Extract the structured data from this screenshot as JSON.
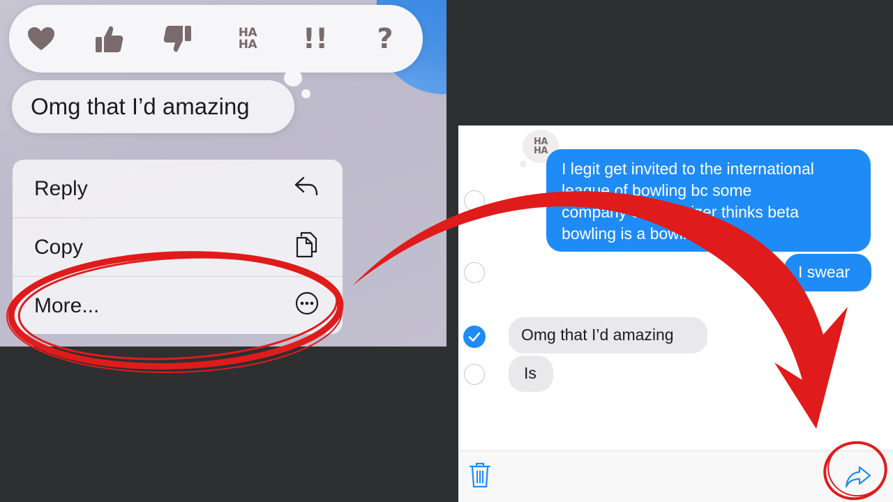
{
  "tapbacks": {
    "heart": "heart-icon",
    "thumbs_up": "thumbs-up-icon",
    "thumbs_down": "thumbs-down-icon",
    "haha_line1": "HA",
    "haha_line2": "HA",
    "emphasis": "!!",
    "question": "?"
  },
  "left_message": "Omg that I’d amazing",
  "context_menu": {
    "reply": "Reply",
    "copy": "Copy",
    "more": "More..."
  },
  "right_thread": {
    "reaction_line1": "HA",
    "reaction_line2": "HA",
    "messages": [
      {
        "text": "I legit get invited to the international league of bowling bc some company or organizer thinks beta bowling is a bowling club",
        "sender": "me"
      },
      {
        "text": "I swear",
        "sender": "me"
      },
      {
        "text": "Omg that I’d amazing",
        "sender": "them",
        "selected": true
      },
      {
        "text": "Is",
        "sender": "them",
        "selected": false
      }
    ],
    "message_lines": [
      "I legit get invited to the international",
      "league of bowling bc some",
      "company or organizer thinks beta",
      "bowling is a bowling club"
    ]
  },
  "toolbar": {
    "delete_icon": "trash-icon",
    "forward_icon": "forward-arrow-icon"
  },
  "colors": {
    "imessage_blue": "#1e8bf7",
    "gray_bubble": "#e9e9eb",
    "annotation_red": "#e01b1b",
    "tapback_icon": "#7a6a6c"
  }
}
